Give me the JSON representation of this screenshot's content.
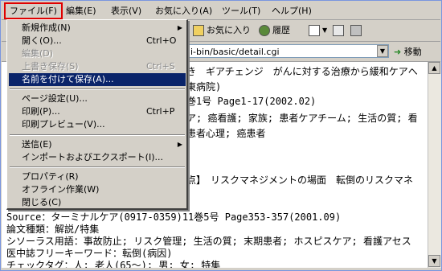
{
  "menubar": {
    "file": "ファイル(F)",
    "edit": "編集(E)",
    "view": "表示(V)",
    "favorites": "お気に入り(A)",
    "tools": "ツール(T)",
    "help": "ヘルプ(H)"
  },
  "toolbar": {
    "favorites": "お気に入り",
    "history": "履歴"
  },
  "address": {
    "value": "i-bin/basic/detail.cgi",
    "go": "移動"
  },
  "file_menu": {
    "new": "新規作成(N)",
    "open": "開く(O)...",
    "open_sc": "Ctrl+O",
    "edit": "編集(D)",
    "save": "上書き保存(S)",
    "save_sc": "Ctrl+S",
    "save_as": "名前を付けて保存(A)...",
    "page_setup": "ページ設定(U)...",
    "print": "印刷(P)...",
    "print_sc": "Ctrl+P",
    "print_preview": "印刷プレビュー(V)...",
    "send": "送信(E)",
    "import_export": "インポートおよびエクスポート(I)...",
    "properties": "プロパティ(R)",
    "offline": "オフライン作業(W)",
    "close": "閉じる(C)"
  },
  "content": {
    "line1": "き　ギアチェンジ　がんに対する治療から緩和ケアへ",
    "line2": "東病院)",
    "line3": "巻1号 Page1-17(2002.02)",
    "line4": "ア; 癌看護; 家族; 患者ケアチーム; 生活の質; 看",
    "line5": "患者心理; 癌患者",
    "line6": "点】　リスクマネジメントの場面　転倒のリスクマネ",
    "line7": "Source：ターミナルケア(0917-0359)11巻5号 Page353-357(2001.09)",
    "line8": "論文種類：解説/特集",
    "line9": "シソーラス用語：事故防止; リスク管理; 生活の質; 末期患者; ホスピスケア; 看護アセス",
    "line10": "医中誌フリーキーワード：転倒(病因)",
    "line11": "チェックタグ：人; 老人(65～); 男; 女; 特集"
  }
}
